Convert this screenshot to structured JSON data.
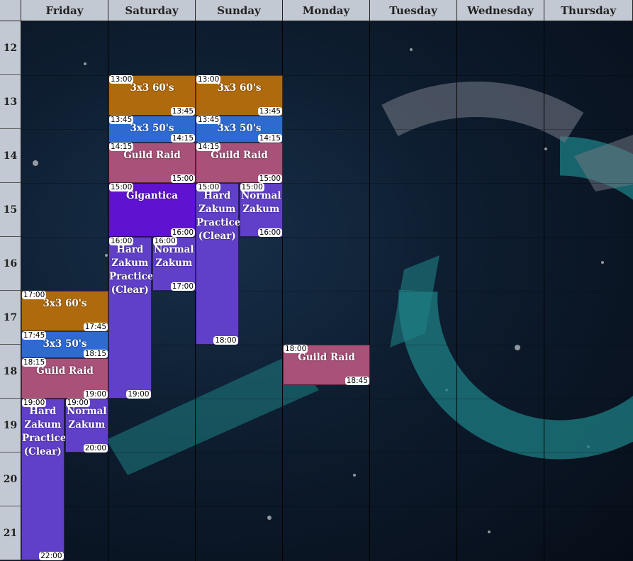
{
  "days": [
    "Friday",
    "Saturday",
    "Sunday",
    "Monday",
    "Tuesday",
    "Wednesday",
    "Thursday"
  ],
  "hours": [
    "12",
    "13",
    "14",
    "15",
    "16",
    "17",
    "18",
    "19",
    "20",
    "21"
  ],
  "colors": {
    "gpq60": "#b06a0e",
    "gpq50": "#2f6ad0",
    "guild_raid": "#a85179",
    "gigantica": "#5f12d0",
    "zakum": "#6040c8"
  },
  "events": [
    {
      "title": "3x3 60's",
      "start": "17:00",
      "end": "17:45",
      "color": "gpq60"
    },
    {
      "title": "3x3 50's",
      "start": "17:45",
      "end": "18:15",
      "color": "gpq50"
    },
    {
      "title": "Guild Raid",
      "start": "18:15",
      "end": "19:00",
      "color": "guild_raid"
    },
    {
      "title": "Hard\nZakum\nPractice\n(Clear)",
      "start": "19:00",
      "end": "22:00",
      "color": "zakum"
    },
    {
      "title": "Normal\nZakum",
      "start": "19:00",
      "end": "20:00",
      "color": "zakum"
    },
    {
      "title": "3x3 60's",
      "start": "13:00",
      "end": "13:45",
      "color": "gpq60"
    },
    {
      "title": "3x3 50's",
      "start": "13:45",
      "end": "14:15",
      "color": "gpq50"
    },
    {
      "title": "Guild Raid",
      "start": "14:15",
      "end": "15:00",
      "color": "guild_raid"
    },
    {
      "title": "Gigantica",
      "start": "15:00",
      "end": "16:00",
      "color": "gigantica"
    },
    {
      "title": "Hard\nZakum\nPractice\n(Clear)",
      "start": "16:00",
      "end": "19:00",
      "color": "zakum"
    },
    {
      "title": "Normal\nZakum",
      "start": "16:00",
      "end": "17:00",
      "color": "zakum"
    },
    {
      "title": "3x3 60's",
      "start": "13:00",
      "end": "13:45",
      "color": "gpq60"
    },
    {
      "title": "3x3 50's",
      "start": "13:45",
      "end": "14:15",
      "color": "gpq50"
    },
    {
      "title": "Guild Raid",
      "start": "14:15",
      "end": "15:00",
      "color": "guild_raid"
    },
    {
      "title": "Hard\nZakum\nPractice\n(Clear)",
      "start": "15:00",
      "end": "18:00",
      "color": "zakum"
    },
    {
      "title": "Normal\nZakum",
      "start": "15:00",
      "end": "16:00",
      "color": "zakum"
    },
    {
      "title": "Guild Raid",
      "start": "18:00",
      "end": "18:45",
      "color": "guild_raid"
    }
  ]
}
